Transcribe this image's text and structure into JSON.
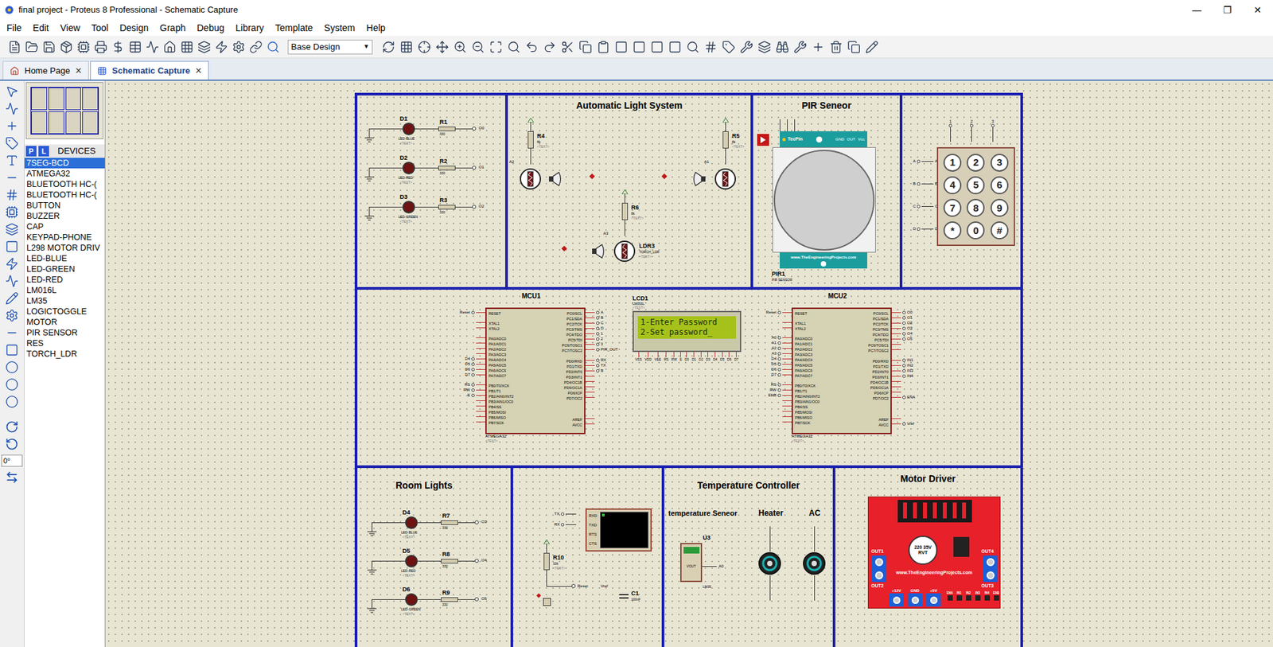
{
  "window": {
    "title": "final project - Proteus 8 Professional - Schematic Capture",
    "controls": [
      "—",
      "❐",
      "✕"
    ]
  },
  "menu": [
    "File",
    "Edit",
    "View",
    "Tool",
    "Design",
    "Graph",
    "Debug",
    "Library",
    "Template",
    "System",
    "Help"
  ],
  "toolbar": {
    "layer": "Base Design"
  },
  "tabs": [
    {
      "label": "Home Page",
      "selected": false,
      "close": "×"
    },
    {
      "label": "Schematic Capture",
      "selected": true,
      "close": "×"
    }
  ],
  "devices": {
    "modes": [
      "P",
      "L"
    ],
    "header": "DEVICES",
    "items": [
      {
        "label": "7SEG-BCD",
        "selected": true
      },
      {
        "label": "ATMEGA32",
        "selected": false
      },
      {
        "label": "BLUETOOTH HC-(",
        "selected": false
      },
      {
        "label": "BLUETOOTH HC-(",
        "selected": false
      },
      {
        "label": "BUTTON",
        "selected": false
      },
      {
        "label": "BUZZER",
        "selected": false
      },
      {
        "label": "CAP",
        "selected": false
      },
      {
        "label": "KEYPAD-PHONE",
        "selected": false
      },
      {
        "label": "L298 MOTOR DRIV",
        "selected": false
      },
      {
        "label": "LED-BLUE",
        "selected": false
      },
      {
        "label": "LED-GREEN",
        "selected": false
      },
      {
        "label": "LED-RED",
        "selected": false
      },
      {
        "label": "LM016L",
        "selected": false
      },
      {
        "label": "LM35",
        "selected": false
      },
      {
        "label": "LOGICTOGGLE",
        "selected": false
      },
      {
        "label": "MOTOR",
        "selected": false
      },
      {
        "label": "PIR SENSOR",
        "selected": false
      },
      {
        "label": "RES",
        "selected": false
      },
      {
        "label": "TORCH_LDR",
        "selected": false
      }
    ]
  },
  "rotation": "0°",
  "schematic": {
    "placeholder": "<TEXT>",
    "status_leds": [
      {
        "ref": "D1",
        "part": "LED-BLUE",
        "res": "R1",
        "value": "330",
        "net": "O0"
      },
      {
        "ref": "D2",
        "part": "LED-RED",
        "res": "R2",
        "value": "330",
        "net": "O1"
      },
      {
        "ref": "D3",
        "part": "LED-GREEN",
        "res": "R3",
        "value": "330",
        "net": "O2"
      }
    ],
    "auto_light": {
      "title": "Automatic Light System",
      "resistors": [
        {
          "ref": "R4",
          "value": "8k",
          "net": "A2"
        },
        {
          "ref": "R5",
          "value": "8k",
          "net": "A1"
        },
        {
          "ref": "R6",
          "value": "8k",
          "net": "A3"
        }
      ],
      "ldr": {
        "ref": "LDR3",
        "part": "TORCH_LDR"
      }
    },
    "pir": {
      "title": "PIR Seneor",
      "brand": "TecPin",
      "pins": [
        "GND",
        "OUT",
        "Vcc"
      ],
      "site": "www.TheEngineeringProjects.com",
      "ref": "PIR1",
      "part": "PIR SENSOR"
    },
    "keypad": {
      "rows": [
        "A",
        "B",
        "C",
        "D"
      ],
      "cols": [
        "1",
        "2",
        "3"
      ],
      "keys": [
        "1",
        "2",
        "3",
        "4",
        "5",
        "6",
        "7",
        "8",
        "9",
        "*",
        "0",
        "#"
      ]
    },
    "mcu_pins": {
      "left": [
        "RESET",
        "XTAL1",
        "XTAL2",
        "PA0/ADC0",
        "PA1/ADC1",
        "PA2/ADC2",
        "PA3/ADC3",
        "PA4/ADC4",
        "PA5/ADC5",
        "PA6/ADC6",
        "PA7/ADC7",
        "PB0/T0/XCK",
        "PB1/T1",
        "PB2/AIN0/INT2",
        "PB3/AIN1/OC0",
        "PB4/SS",
        "PB5/MOSI",
        "PB6/MISO",
        "PB7/SCK"
      ],
      "right": [
        "PC0/SCL",
        "PC1/SDA",
        "PC2/TCK",
        "PC3/TMS",
        "PC4/TDO",
        "PC5/TDI",
        "PC6/TOSC1",
        "PC7/TOSC2",
        "PD0/RXD",
        "PD1/TXD",
        "PD2/INT0",
        "PD3/INT1",
        "PD4/OC1B",
        "PD5/OC1A",
        "PD6/ICP",
        "PD7/OC2",
        "AREF",
        "AVCC"
      ]
    },
    "mcus": [
      {
        "ref": "MCU1",
        "part": "ATMEGA32",
        "left_nets": [
          "Reset",
          "",
          "",
          "",
          "",
          "",
          "",
          "D4",
          "D5",
          "D6",
          "D7",
          "RS",
          "RW",
          "E",
          "",
          "",
          "",
          "",
          ""
        ],
        "right_nets": [
          "A",
          "B",
          "C",
          "D",
          "1",
          "2",
          "3",
          "PIR_OUT",
          "RX",
          "TX",
          "B",
          "",
          "",
          "",
          "",
          "",
          "",
          ""
        ]
      },
      {
        "ref": "MCU2",
        "part": "ATMEGA32",
        "left_nets": [
          "Reset",
          "",
          "",
          "A0",
          "A1",
          "A2",
          "A3",
          "D4",
          "D5",
          "D6",
          "D7",
          "RS",
          "RW",
          "ENB",
          "",
          "",
          "",
          "",
          ""
        ],
        "right_nets": [
          "O0",
          "O1",
          "O2",
          "O3",
          "O4",
          "O5",
          "",
          "",
          "IN1",
          "IN2",
          "IN3",
          "IN4",
          "",
          "",
          "",
          "ENA",
          "",
          "Vref"
        ]
      }
    ],
    "lcd": {
      "ref": "LCD1",
      "part": "LM016L",
      "lines": [
        "1-Enter Password",
        "2-Set password_"
      ],
      "pins": [
        "VSS",
        "VDD",
        "VEE",
        "RS",
        "RW",
        "E",
        "D0",
        "D1",
        "D2",
        "D3",
        "D4",
        "D5",
        "D6",
        "D7"
      ]
    },
    "room_lights": {
      "title": "Room Lights",
      "leds": [
        {
          "ref": "D4",
          "part": "LED-BLUE",
          "res": "R7",
          "value": "330",
          "net": "O3"
        },
        {
          "ref": "D5",
          "part": "LED-RED",
          "res": "R8",
          "value": "330",
          "net": "O4"
        },
        {
          "ref": "D6",
          "part": "LED-GREEN",
          "res": "R9",
          "value": "330",
          "net": "O5"
        }
      ]
    },
    "terminal": {
      "pins": [
        "RXD",
        "TXD",
        "RTS",
        "CTS"
      ],
      "nets": [
        "TX",
        "RX"
      ],
      "res": {
        "ref": "R10",
        "value": "10k"
      },
      "reset": "Reset",
      "vref": "Vref",
      "cap": {
        "ref": "C1",
        "value": "100nF"
      }
    },
    "temperature": {
      "title": "Temperature Controller",
      "sensor_label": "temperature Seneor",
      "heater": "Heater",
      "ac": "AC",
      "ref": "U3",
      "part": "LM35",
      "pin": "VOUT",
      "net": "A0"
    },
    "motor_driver": {
      "title": "Motor Driver",
      "outputs": [
        "OUT1",
        "OUT2",
        "OUT3",
        "OUT4"
      ],
      "power": [
        "+12V",
        "GND",
        "+5V"
      ],
      "cap": "220 35V RVT",
      "site": "www.TheEngineeringProjects.com",
      "header": [
        "ENA",
        "IN1",
        "IN2",
        "IN3",
        "IN4",
        "ENB"
      ]
    }
  }
}
